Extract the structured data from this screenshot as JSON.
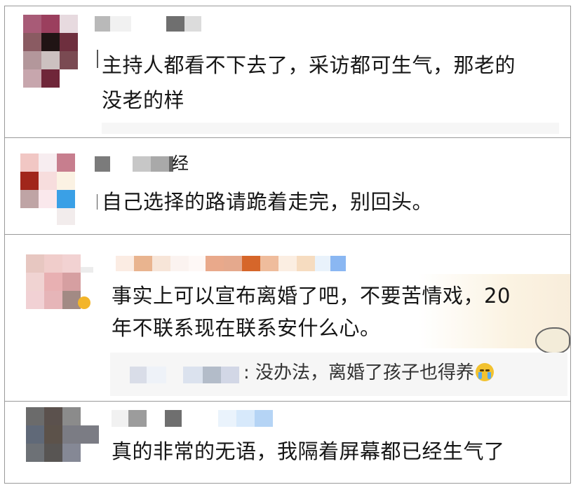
{
  "comments": [
    {
      "text_line1": "主持人都看不下去了，采访都可生气，那老的",
      "text_line2": "没老的样"
    },
    {
      "name_suffix": "经",
      "text_line1": "自己选择的路请跪着走完，别回头。"
    },
    {
      "text_line1": "事实上可以宣布离婚了吧，不要苦情戏，20",
      "text_line2": "年不联系现在联系安什么心。",
      "reply_text": ": 没办法，离婚了孩子也得养",
      "reply_emoji": "crying-face-icon"
    },
    {
      "text_line1": "真的非常的无语，我隔着屏幕都已经生气了"
    }
  ]
}
